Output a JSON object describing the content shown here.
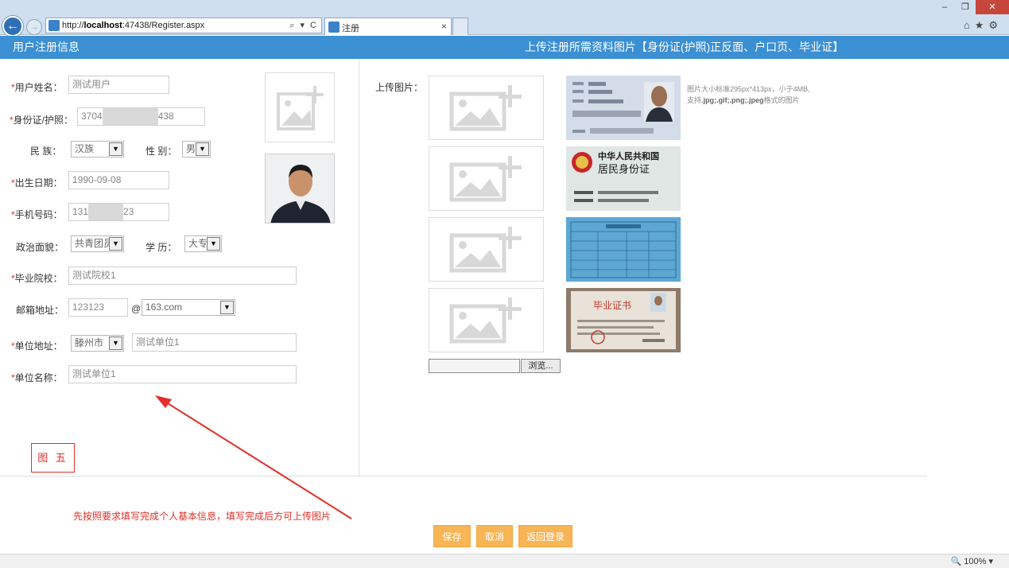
{
  "browser": {
    "url_prefix": "http://",
    "url_host": "localhost",
    "url_rest": ":47438/Register.aspx",
    "addr_controls": "⌕ ▾ C",
    "tab_title": "注册",
    "tab_close": "×",
    "zoom": "100%"
  },
  "header": {
    "left_title": "用户注册信息",
    "right_title": "上传注册所需资料图片【身份证(护照)正反面、户口页、毕业证】"
  },
  "form": {
    "required_mark": "*",
    "name_label": "用户姓名：",
    "name_value": "测试用户",
    "id_label": "身份证/护照：",
    "id_prefix": "3704",
    "id_suffix": "438",
    "ethnic_label": "民 族：",
    "ethnic_value": "汉族",
    "gender_label": "性 别：",
    "gender_value": "男",
    "birth_label": "出生日期：",
    "birth_value": "1990-09-08",
    "phone_label": "手机号码：",
    "phone_prefix": "131",
    "phone_suffix": "23",
    "politic_label": "政治面貌：",
    "politic_value": "共青团员",
    "edu_label": "学 历：",
    "edu_value": "大专",
    "school_label": "毕业院校：",
    "school_value": "测试院校1",
    "email_label": "邮箱地址：",
    "email_user": "123123",
    "email_at": "@",
    "email_domain": "163.com",
    "unit_addr_label": "单位地址：",
    "unit_city": "滕州市",
    "unit_addr_value": "测试单位1",
    "unit_name_label": "单位名称：",
    "unit_name_value": "测试单位1"
  },
  "annotation": {
    "figure_label": "图 五",
    "hint": "先按照要求填写完成个人基本信息，填写完成后方可上传图片"
  },
  "upload": {
    "label": "上传图片：",
    "note_line1": "图片大小标准295px*413px，小于4MB,",
    "note_line2_prefix": "支持",
    "note_formats": ".jpg;.gif;.png;.jpeg",
    "note_line2_suffix": "格式的图片",
    "browse_label": "浏览...",
    "card_title_1": "中华人民共和国",
    "card_title_2": "居民身份证",
    "cert_title": "毕业证书"
  },
  "buttons": {
    "save": "保存",
    "cancel": "取消",
    "back_login": "返回登录"
  },
  "icons": {
    "back": "←",
    "forward": "→",
    "home": "⌂",
    "star": "★",
    "gear": "⚙"
  },
  "colors": {
    "header_blue": "#3b8fd3",
    "button_orange": "#f7b556",
    "required_red": "#e0302a"
  }
}
